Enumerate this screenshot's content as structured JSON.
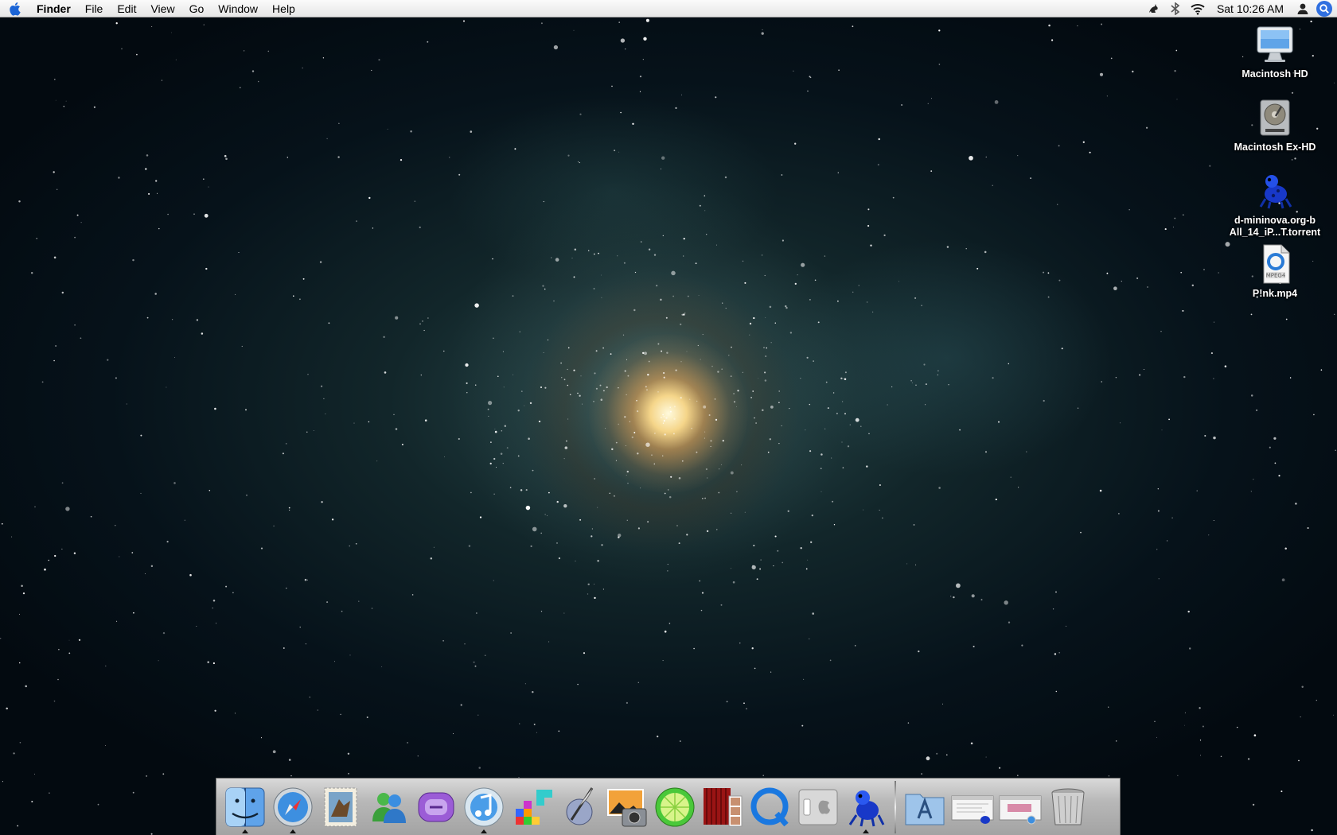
{
  "menubar": {
    "apple_icon": "apple-icon",
    "app_name": "Finder",
    "menus": [
      "File",
      "Edit",
      "View",
      "Go",
      "Window",
      "Help"
    ],
    "status_icons": [
      "growl-icon",
      "bluetooth-icon",
      "wifi-icon"
    ],
    "clock": "Sat 10:26 AM",
    "user_icon": "user-icon",
    "spotlight_icon": "spotlight-icon"
  },
  "desktop": {
    "icons": [
      {
        "label": "Macintosh HD",
        "icon": "imac-icon"
      },
      {
        "label": "Macintosh Ex-HD",
        "icon": "hard-drive-icon"
      },
      {
        "label": "d-mininova.org-b\nAll_14_iP...T.torrent",
        "icon": "torrent-frog-icon"
      },
      {
        "label": "P!nk.mp4",
        "icon": "mpeg4-file-icon"
      }
    ]
  },
  "dock": {
    "apps": [
      {
        "name": "Finder",
        "icon": "finder-icon",
        "running": true
      },
      {
        "name": "Safari",
        "icon": "safari-icon",
        "running": true
      },
      {
        "name": "Mail",
        "icon": "mail-stamp-icon",
        "running": false
      },
      {
        "name": "Messenger",
        "icon": "messenger-icon",
        "running": false
      },
      {
        "name": "Messenger",
        "icon": "msn-butterfly-icon",
        "running": false
      },
      {
        "name": "iTunes",
        "icon": "itunes-icon",
        "running": true
      },
      {
        "name": "Tetris",
        "icon": "tetris-icon",
        "running": false
      },
      {
        "name": "Script Editor",
        "icon": "quill-icon",
        "running": false
      },
      {
        "name": "iPhoto",
        "icon": "iphoto-icon",
        "running": false
      },
      {
        "name": "LimeWire",
        "icon": "limewire-icon",
        "running": false
      },
      {
        "name": "Photo Booth",
        "icon": "photo-booth-icon",
        "running": false
      },
      {
        "name": "QuickTime",
        "icon": "quicktime-icon",
        "running": false
      },
      {
        "name": "System Preferences",
        "icon": "switch-apple-icon",
        "running": false
      },
      {
        "name": "Transmission",
        "icon": "frog-icon",
        "running": true
      }
    ],
    "docs": [
      {
        "name": "Applications",
        "icon": "applications-folder-icon"
      },
      {
        "name": "Window 1",
        "icon": "minimized-window-1-icon"
      },
      {
        "name": "Window 2",
        "icon": "minimized-window-2-icon"
      },
      {
        "name": "Trash",
        "icon": "trash-icon"
      }
    ]
  }
}
